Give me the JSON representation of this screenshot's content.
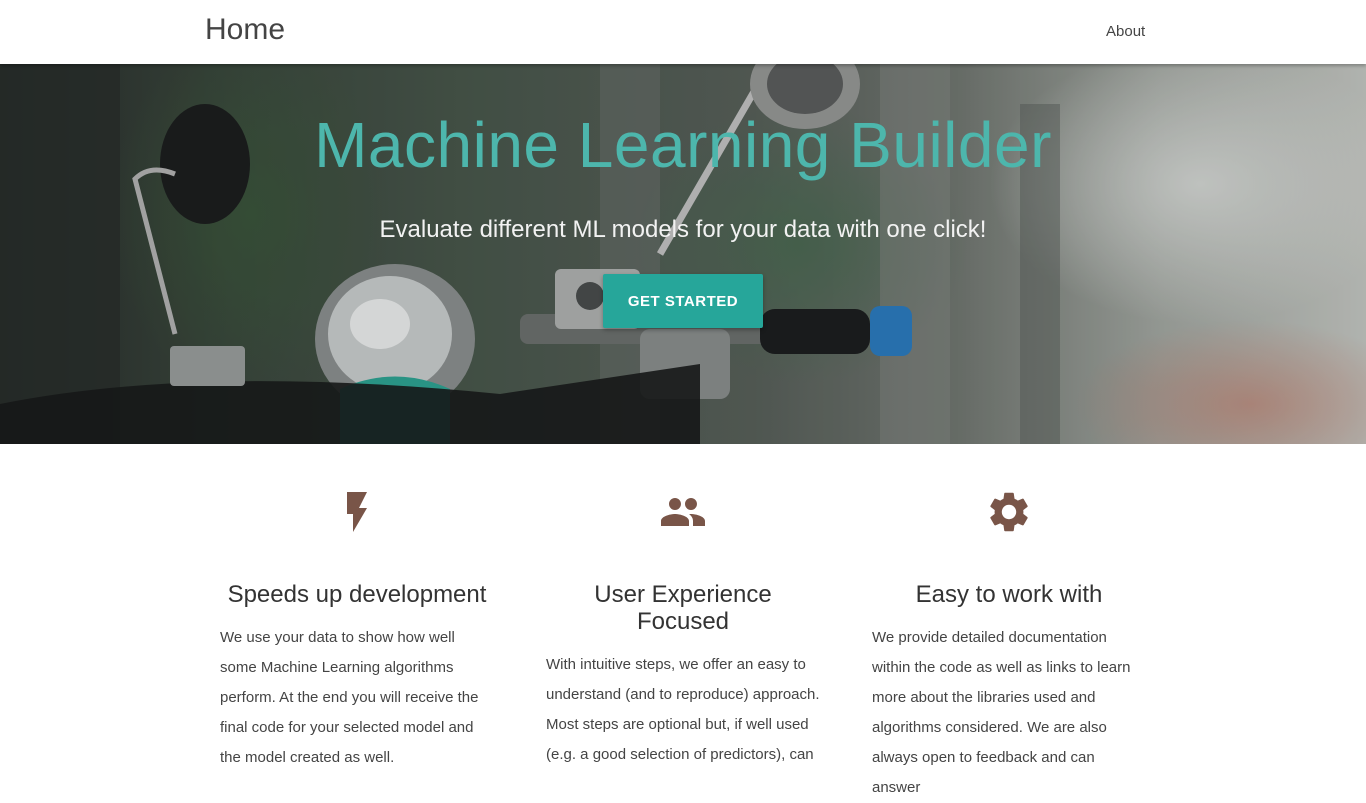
{
  "navbar": {
    "brand": "Home",
    "links": [
      {
        "label": "About"
      }
    ]
  },
  "hero": {
    "title": "Machine Learning Builder",
    "subtitle": "Evaluate different ML models for your data with one click!",
    "cta_label": "GET STARTED"
  },
  "colors": {
    "accent": "#26a69a",
    "title": "#4db6ac",
    "icon": "#795548"
  },
  "features": [
    {
      "icon": "flash-icon",
      "title": "Speeds up development",
      "text": "We use your data to show how well some Machine Learning algorithms perform. At the end you will receive the final code for your selected model and the model created as well."
    },
    {
      "icon": "group-icon",
      "title": "User Experience Focused",
      "text": "With intuitive steps, we offer an easy to understand (and to reproduce) approach. Most steps are optional but, if well used (e.g. a good selection of predictors), can"
    },
    {
      "icon": "settings-icon",
      "title": "Easy to work with",
      "text": "We provide detailed documentation within the code as well as links to learn more about the libraries used and algorithms considered. We are also always open to feedback and can answer"
    }
  ]
}
